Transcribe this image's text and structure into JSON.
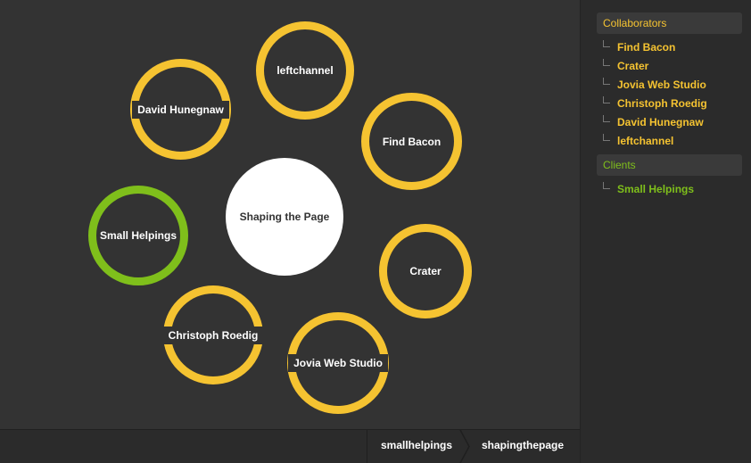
{
  "graph": {
    "center_node": "Shaping the Page",
    "nodes": [
      {
        "label": "leftchannel",
        "type": "collaborator"
      },
      {
        "label": "David Hunegnaw",
        "type": "collaborator"
      },
      {
        "label": "Find Bacon",
        "type": "collaborator"
      },
      {
        "label": "Small Helpings",
        "type": "client"
      },
      {
        "label": "Crater",
        "type": "collaborator"
      },
      {
        "label": "Christoph Roedig",
        "type": "collaborator"
      },
      {
        "label": "Jovia Web Studio",
        "type": "collaborator"
      }
    ]
  },
  "sidebar": {
    "collaborators": {
      "header": "Collaborators",
      "items": [
        "Find Bacon",
        "Crater",
        "Jovia Web Studio",
        "Christoph Roedig",
        "David Hunegnaw",
        "leftchannel"
      ]
    },
    "clients": {
      "header": "Clients",
      "items": [
        "Small Helpings"
      ]
    }
  },
  "breadcrumb": [
    "smallhelpings",
    "shapingthepage"
  ],
  "colors": {
    "collaborator": "#f5c331",
    "client": "#7fbf1b",
    "background": "#333333"
  }
}
